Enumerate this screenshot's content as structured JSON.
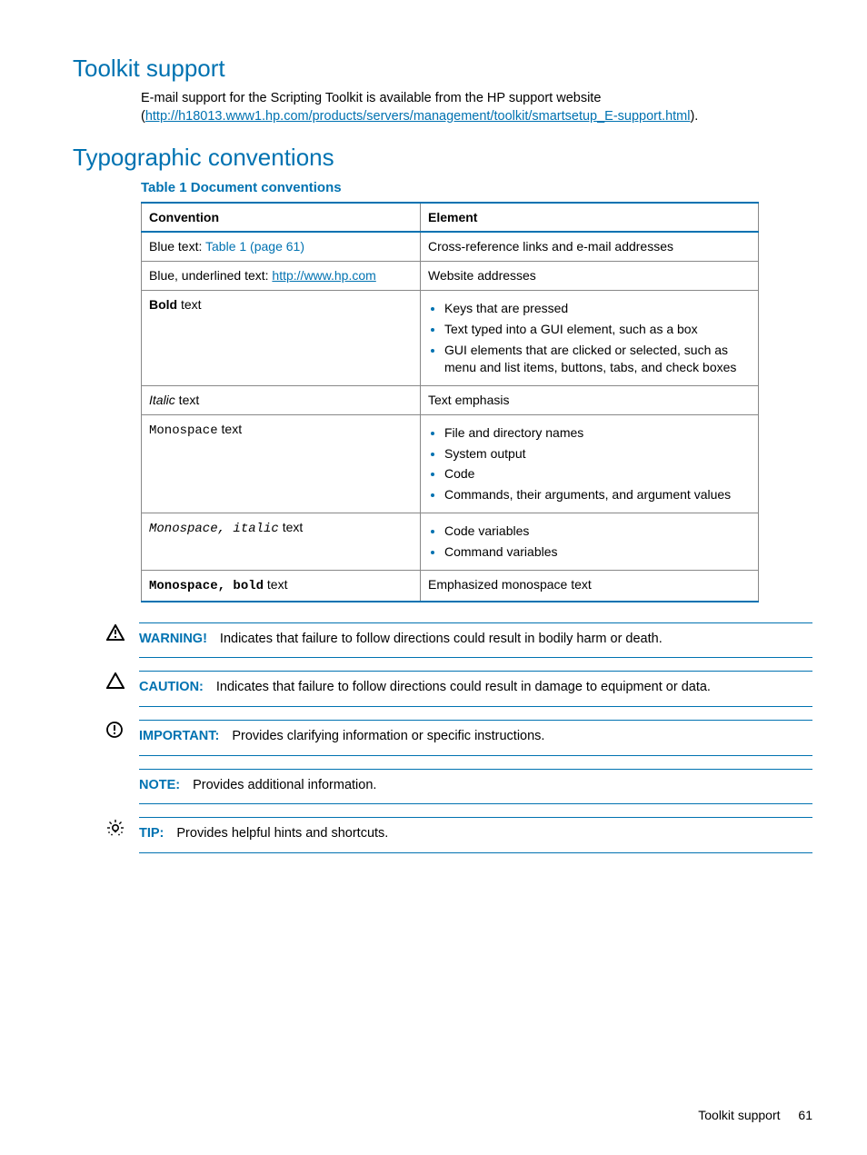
{
  "sections": {
    "toolkit_support": {
      "heading": "Toolkit support",
      "body_pre": "E-mail support for the Scripting Toolkit is available from the HP support website (",
      "link": "http://h18013.www1.hp.com/products/servers/management/toolkit/smartsetup_E-support.html",
      "body_post": ")."
    },
    "typographic": {
      "heading": "Typographic conventions",
      "table_title": "Table 1 Document conventions",
      "col1": "Convention",
      "col2": "Element",
      "rows": {
        "r1": {
          "conv_pre": "Blue text: ",
          "conv_link": "Table 1 (page 61)",
          "elem": "Cross-reference links and e-mail addresses"
        },
        "r2": {
          "conv_pre": "Blue, underlined text: ",
          "conv_link": "http://www.hp.com",
          "elem": "Website addresses"
        },
        "r3": {
          "conv_bold": "Bold",
          "conv_post": " text",
          "li1": "Keys that are pressed",
          "li2": "Text typed into a GUI element, such as a box",
          "li3": "GUI elements that are clicked or selected, such as menu and list items, buttons, tabs, and check boxes"
        },
        "r4": {
          "conv_italic": "Italic",
          "conv_post": " text",
          "elem": "Text emphasis"
        },
        "r5": {
          "conv_mono": "Monospace",
          "conv_post": " text",
          "li1": "File and directory names",
          "li2": "System output",
          "li3": "Code",
          "li4": "Commands, their arguments, and argument values"
        },
        "r6": {
          "conv_mono_italic": "Monospace, italic",
          "conv_post": " text",
          "li1": "Code variables",
          "li2": "Command variables"
        },
        "r7": {
          "conv_mono_bold": "Monospace, bold",
          "conv_post": " text",
          "elem": "Emphasized monospace text"
        }
      }
    }
  },
  "admonitions": {
    "warning": {
      "label": "WARNING!",
      "text": "Indicates that failure to follow directions could result in bodily harm or death."
    },
    "caution": {
      "label": "CAUTION:",
      "text": "Indicates that failure to follow directions could result in damage to equipment or data."
    },
    "important": {
      "label": "IMPORTANT:",
      "text": "Provides clarifying information or specific instructions."
    },
    "note": {
      "label": "NOTE:",
      "text": "Provides additional information."
    },
    "tip": {
      "label": "TIP:",
      "text": "Provides helpful hints and shortcuts."
    }
  },
  "footer": {
    "title": "Toolkit support",
    "page": "61"
  }
}
